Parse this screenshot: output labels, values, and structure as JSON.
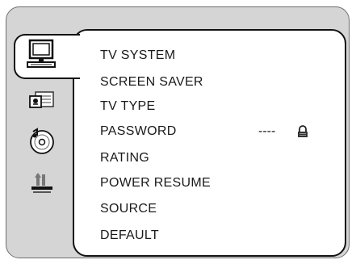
{
  "menu": {
    "items": [
      {
        "label": "TV  SYSTEM"
      },
      {
        "label": "SCREEN SAVER"
      },
      {
        "label": "TV TYPE"
      },
      {
        "label": "PASSWORD"
      },
      {
        "label": "RATING"
      },
      {
        "label": "POWER RESUME"
      },
      {
        "label": "SOURCE"
      },
      {
        "label": "DEFAULT"
      }
    ],
    "selected_index": 3
  },
  "password": {
    "value": "----"
  },
  "side_tabs": [
    {
      "icon": "monitor-icon",
      "active": true
    },
    {
      "icon": "language-icon",
      "active": false
    },
    {
      "icon": "audio-disc-icon",
      "active": false
    },
    {
      "icon": "speaker-settings-icon",
      "active": false
    }
  ],
  "colors": {
    "panel_bg": "#d5d5d5",
    "menu_bg": "#ffffff",
    "border": "#111111",
    "text": "#1a1a1a"
  }
}
